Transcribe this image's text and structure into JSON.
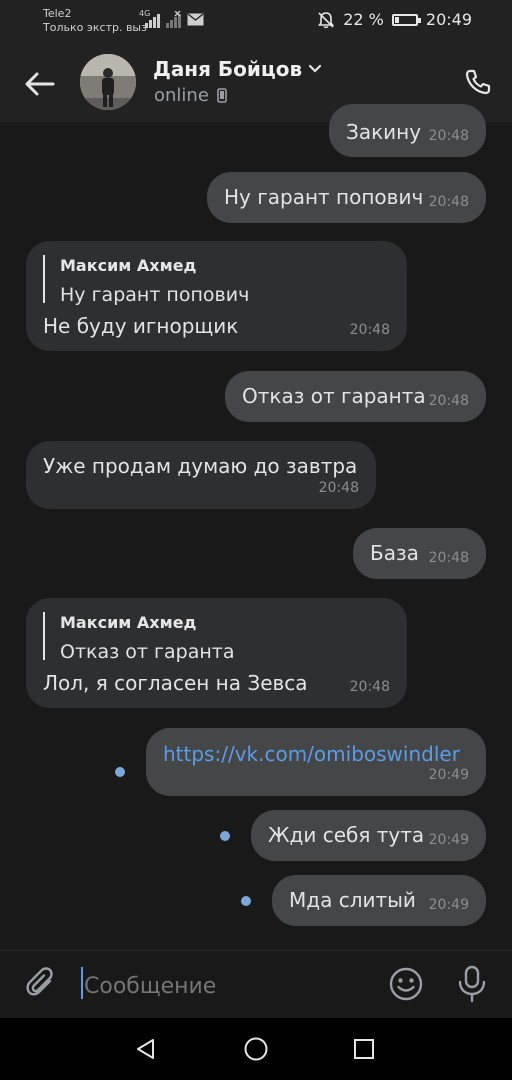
{
  "status_bar": {
    "carrier": "Tele2",
    "carrier_note": "Только экстр. выз",
    "network": "4G",
    "battery": "22 %",
    "time": "20:49"
  },
  "header": {
    "contact_name": "Даня Бойцов",
    "status": "online"
  },
  "messages": [
    {
      "dir": "out",
      "text": "Закину",
      "time": "20:48"
    },
    {
      "dir": "out",
      "text": "Ну гарант попович",
      "time": "20:48"
    },
    {
      "dir": "in",
      "reply_name": "Максим Ахмед",
      "reply_text": "Ну гарант попович",
      "text": "Не буду игнорщик",
      "time": "20:48"
    },
    {
      "dir": "out",
      "text": "Отказ от гаранта",
      "time": "20:48"
    },
    {
      "dir": "in",
      "text": "Уже продам думаю до завтра",
      "time": "20:48"
    },
    {
      "dir": "out",
      "text": "База",
      "time": "20:48"
    },
    {
      "dir": "in",
      "reply_name": "Максим Ахмед",
      "reply_text": "Отказ от гаранта",
      "text": "Лол, я согласен на Зевса",
      "time": "20:48"
    },
    {
      "dir": "out",
      "text": "https://vk.com/omiboswindler",
      "time": "20:49",
      "unread": true,
      "is_link": true
    },
    {
      "dir": "out",
      "text": "Жди себя тута",
      "time": "20:49",
      "unread": true
    },
    {
      "dir": "out",
      "text": "Мда слитый",
      "time": "20:49",
      "unread": true
    }
  ],
  "composer": {
    "placeholder": "Сообщение"
  },
  "colors": {
    "background": "#19191a",
    "header": "#222222",
    "incoming_bubble": "#2e2f31",
    "outgoing_bubble": "#454647",
    "link": "#5c9ce6",
    "unread_dot": "#7ea6d8"
  },
  "icons": [
    "back-arrow-icon",
    "chevron-down-icon",
    "mobile-icon",
    "phone-icon",
    "attach-icon",
    "emoji-icon",
    "microphone-icon",
    "nav-back-icon",
    "nav-home-icon",
    "nav-recents-icon"
  ]
}
